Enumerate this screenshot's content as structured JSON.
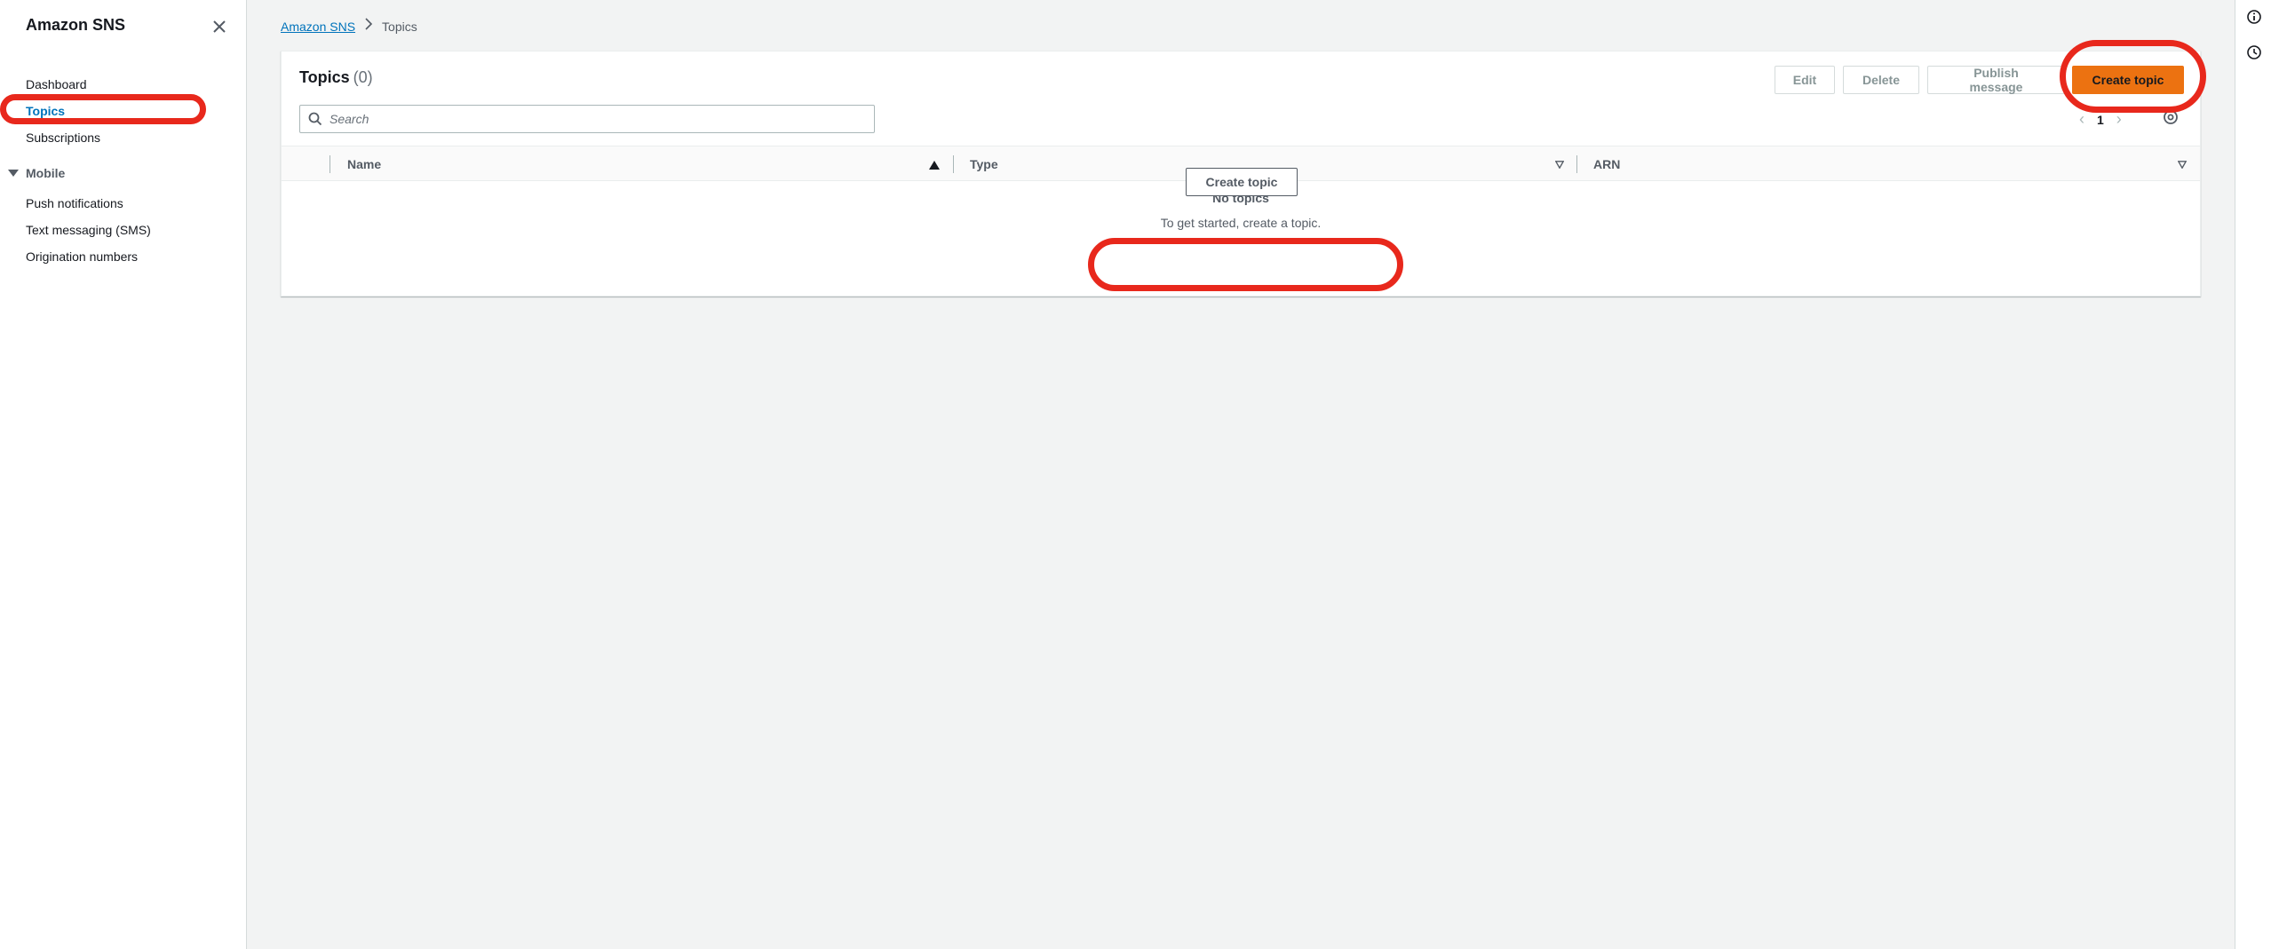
{
  "sidebar": {
    "title": "Amazon SNS",
    "items": [
      {
        "label": "Dashboard"
      },
      {
        "label": "Topics",
        "active": true
      },
      {
        "label": "Subscriptions"
      }
    ],
    "section": {
      "label": "Mobile",
      "items": [
        {
          "label": "Push notifications"
        },
        {
          "label": "Text messaging (SMS)"
        },
        {
          "label": "Origination numbers"
        }
      ]
    }
  },
  "breadcrumb": {
    "root": "Amazon SNS",
    "current": "Topics"
  },
  "panel": {
    "title": "Topics",
    "count": "(0)",
    "buttons": {
      "edit": "Edit",
      "delete": "Delete",
      "publish": "Publish message",
      "create": "Create topic"
    },
    "search_placeholder": "Search",
    "pagination": {
      "page": "1",
      "prev": "‹",
      "next": "›"
    },
    "columns": [
      "Name",
      "Type",
      "ARN"
    ],
    "empty": {
      "title": "No topics",
      "subtitle": "To get started, create a topic.",
      "button": "Create topic"
    }
  },
  "colors": {
    "accent": "#0073bb",
    "primary_button": "#ec7211",
    "annotation_ring": "#e8281c"
  }
}
